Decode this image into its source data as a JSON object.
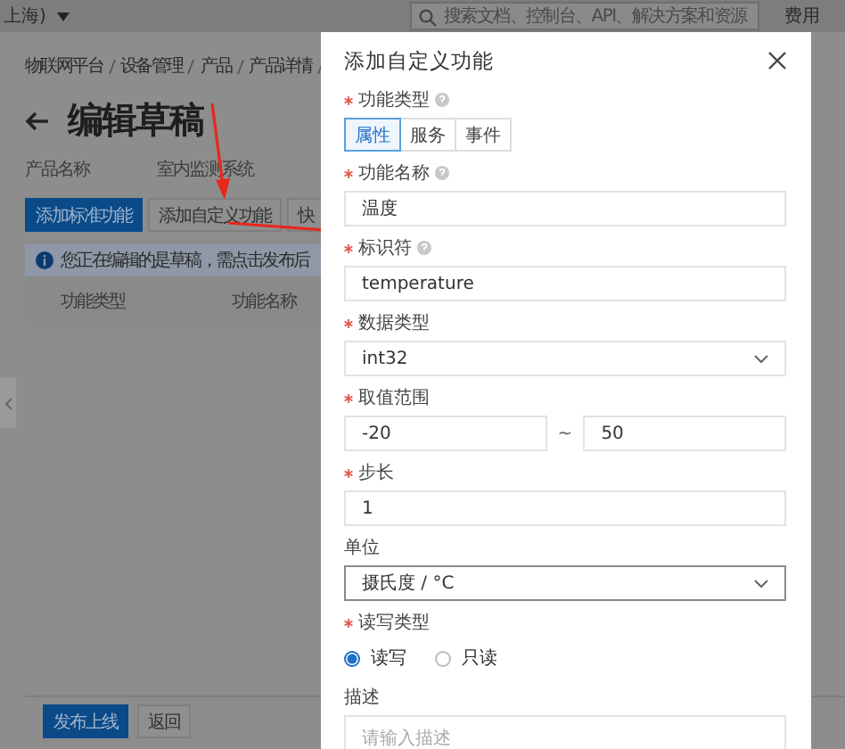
{
  "top_bar": {
    "region": "上海)",
    "search": {
      "placeholder": "搜索文档、控制台、API、解决方案和资源"
    },
    "links": [
      "费用"
    ]
  },
  "breadcrumb": [
    "物联网平台",
    "设备管理",
    "产品",
    "产品详情"
  ],
  "page": {
    "title": "编辑草稿",
    "product_label": "产品名称",
    "product_value": "室内监测系统"
  },
  "toolbar_buttons": [
    {
      "label": "添加标准功能",
      "kind": "primary"
    },
    {
      "label": "添加自定义功能",
      "kind": "default"
    },
    {
      "label": "快",
      "kind": "default"
    }
  ],
  "notice": "您正在编辑的是草稿，需点击发布后",
  "table": {
    "columns": [
      "功能类型",
      "功能名称"
    ]
  },
  "footer_buttons": [
    {
      "label": "发布上线",
      "kind": "primary"
    },
    {
      "label": "返回",
      "kind": "default"
    }
  ],
  "dialog": {
    "title": "添加自定义功能",
    "fields": [
      {
        "kind": "segmented",
        "label": "功能类型",
        "required": true,
        "help": true,
        "options": [
          {
            "label": "属性",
            "selected": true
          },
          {
            "label": "服务",
            "selected": false
          },
          {
            "label": "事件",
            "selected": false
          }
        ]
      },
      {
        "kind": "text",
        "label": "功能名称",
        "required": true,
        "help": true,
        "value": "温度"
      },
      {
        "kind": "text",
        "label": "标识符",
        "required": true,
        "help": true,
        "value": "temperature"
      },
      {
        "kind": "select",
        "label": "数据类型",
        "required": true,
        "help": false,
        "value": "int32",
        "focused": false
      },
      {
        "kind": "range",
        "label": "取值范围",
        "required": true,
        "help": false,
        "min": "-20",
        "separator": "~",
        "max": "50"
      },
      {
        "kind": "text",
        "label": "步长",
        "required": true,
        "help": false,
        "value": "1"
      },
      {
        "kind": "select",
        "label": "单位",
        "required": false,
        "help": false,
        "value": "摄氏度 / °C",
        "focused": true
      },
      {
        "kind": "radio",
        "label": "读写类型",
        "required": true,
        "help": false,
        "options": [
          {
            "label": "读写",
            "selected": true
          },
          {
            "label": "只读",
            "selected": false
          }
        ]
      },
      {
        "kind": "textarea",
        "label": "描述",
        "required": false,
        "help": false,
        "placeholder": "请输入描述"
      }
    ]
  }
}
